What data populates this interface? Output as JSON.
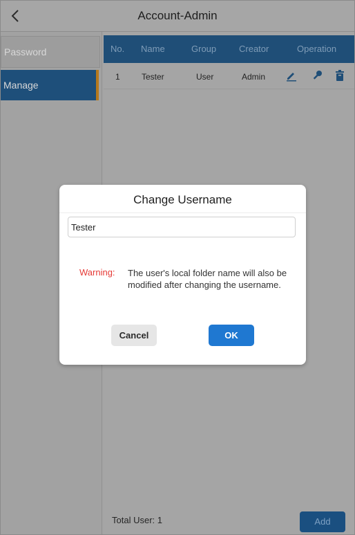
{
  "header": {
    "title": "Account-Admin",
    "back_icon": "chevron-left-icon"
  },
  "sidebar": {
    "items": [
      {
        "label": "Password"
      },
      {
        "label": "Manage"
      }
    ]
  },
  "table": {
    "columns": [
      "No.",
      "Name",
      "Group",
      "Creator",
      "Operation"
    ],
    "rows": [
      {
        "no": "1",
        "name": "Tester",
        "group": "User",
        "creator": "Admin",
        "operations": [
          "edit-icon",
          "key-icon",
          "delete-icon"
        ]
      }
    ]
  },
  "footer": {
    "total_label": "Total User: 1",
    "add_label": "Add"
  },
  "dialog": {
    "title": "Change Username",
    "input_value": "Tester",
    "warning_label": "Warning:",
    "warning_text": "The user's local folder name will also be modified after changing the username.",
    "cancel_label": "Cancel",
    "ok_label": "OK"
  },
  "colors": {
    "accent": "#1f78d1",
    "header_bar": "#1f4e77",
    "warning": "#e53935",
    "selected_indicator": "#b6791c"
  }
}
